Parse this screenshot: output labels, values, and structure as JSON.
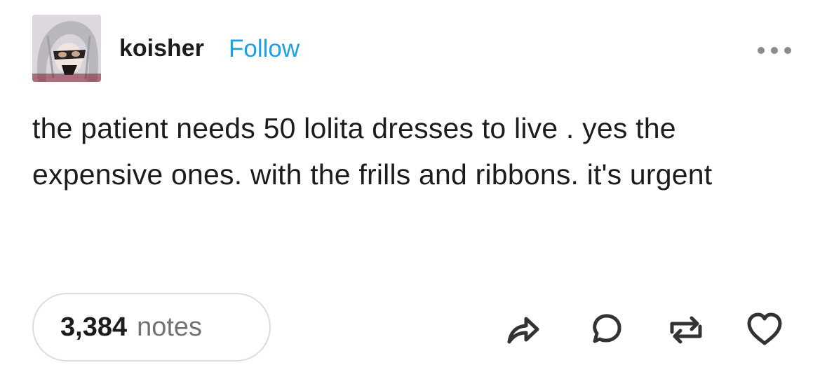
{
  "post": {
    "username": "koisher",
    "follow_label": "Follow",
    "text": "the patient needs 50 lolita dresses to live . yes the expensive ones. with the frills and ribbons. it's urgent",
    "notes_count": "3,384",
    "notes_label": "notes"
  },
  "icons": {
    "more": "more-options-icon",
    "share": "share-icon",
    "reply": "reply-icon",
    "reblog": "reblog-icon",
    "like": "heart-icon"
  },
  "colors": {
    "follow": "#1aa1e6",
    "text": "#1c1c1c",
    "muted": "#737373",
    "icon": "#333333"
  }
}
